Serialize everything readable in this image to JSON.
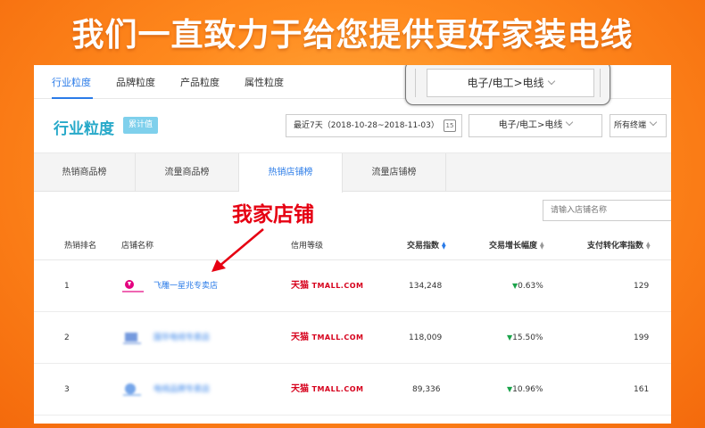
{
  "banner": "我们一直致力于给您提供更好家装电线",
  "top_tabs": [
    "行业粒度",
    "品牌粒度",
    "产品粒度",
    "属性粒度"
  ],
  "zoom_category": "电子/电工>电线",
  "page_title": "行业粒度",
  "badge": "累计值",
  "date_range": "最近7天（2018-10-28~2018-11-03）",
  "calendar_day": "15",
  "category": "电子/电工>电线",
  "terminal": "所有终端",
  "sub_tabs": [
    "热销商品榜",
    "流量商品榜",
    "热销店铺榜",
    "流量店铺榜"
  ],
  "annotation": "我家店铺",
  "search_placeholder": "请输入店铺名称",
  "columns": {
    "rank": "热销排名",
    "shop": "店铺名称",
    "credit": "信用等级",
    "trade_index": "交易指数",
    "growth": "交易增长幅度",
    "conversion": "支付转化率指数"
  },
  "credit_cn": "天猫",
  "credit_en": "TMALL.COM",
  "rows": [
    {
      "rank": "1",
      "shop": "飞雕一星兆专卖店",
      "trade_index": "134,248",
      "growth": "0.63%",
      "conversion": "129"
    },
    {
      "rank": "2",
      "shop": "国华电线专卖店",
      "trade_index": "118,009",
      "growth": "15.50%",
      "conversion": "199"
    },
    {
      "rank": "3",
      "shop": "电线品牌专卖店",
      "trade_index": "89,336",
      "growth": "10.96%",
      "conversion": "161"
    }
  ],
  "colors": {
    "accent": "#2a7be8",
    "title": "#27a9c9",
    "annotation": "#e60012",
    "tmall": "#d6001c",
    "down": "#1aa34a"
  }
}
